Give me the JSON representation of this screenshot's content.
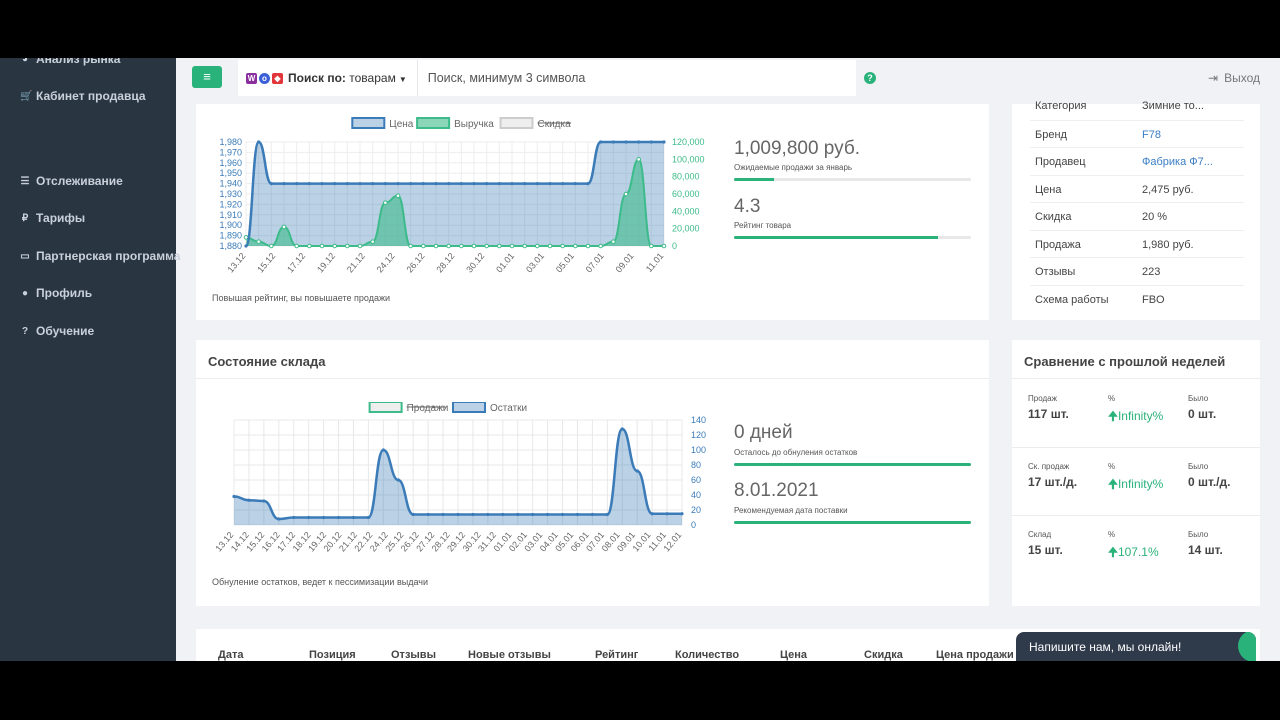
{
  "sidebar": {
    "items": [
      {
        "icon": "pie-chart-icon",
        "label": "Анализ рынка"
      },
      {
        "icon": "cart-icon",
        "label": "Кабинет продавца"
      },
      {
        "icon": "list-icon",
        "label": "Отслеживание"
      },
      {
        "icon": "ruble-icon",
        "label": "Тарифы"
      },
      {
        "icon": "id-card-icon",
        "label": "Партнерская программа"
      },
      {
        "icon": "user-icon",
        "label": "Профиль"
      },
      {
        "icon": "question-icon",
        "label": "Обучение"
      }
    ]
  },
  "topbar": {
    "search_by_label": "Поиск по:",
    "search_by_value": "товарам",
    "search_placeholder": "Поиск, минимум 3 символа",
    "help": "?",
    "logout": "Выход"
  },
  "sales_card": {
    "revenue_value": "1,009,800 руб.",
    "revenue_caption": "Ожидаемые продажи за январь",
    "revenue_progress": 0.17,
    "rating_value": "4.3",
    "rating_caption": "Рейтинг товара",
    "rating_progress": 0.86,
    "note": "Повышая рейтинг, вы повышаете продажи"
  },
  "info": {
    "rows": [
      {
        "k": "Категория",
        "v": "Зимние то..."
      },
      {
        "k": "Бренд",
        "v": "F78",
        "link": true
      },
      {
        "k": "Продавец",
        "v": "Фабрика Ф7...",
        "link": true
      },
      {
        "k": "Цена",
        "v": "2,475 руб."
      },
      {
        "k": "Скидка",
        "v": "20 %"
      },
      {
        "k": "Продажа",
        "v": "1,980 руб."
      },
      {
        "k": "Отзывы",
        "v": "223"
      },
      {
        "k": "Схема работы",
        "v": "FBO"
      }
    ]
  },
  "stock_card": {
    "title": "Состояние склада",
    "days_value": "0 дней",
    "days_caption": "Осталось до обнуления остатков",
    "days_progress": 1.0,
    "date_value": "8.01.2021",
    "date_caption": "Рекомендуемая дата поставки",
    "date_progress": 1.0,
    "note": "Обнуление остатков, ведет к пессимизации выдачи"
  },
  "compare": {
    "title": "Сравнение с прошлой неделей",
    "rows": [
      {
        "l1": "Продаж",
        "v1": "117 шт.",
        "l2": "%",
        "v2": "Infinity%",
        "l3": "Было",
        "v3": "0 шт."
      },
      {
        "l1": "Ск. продаж",
        "v1": "17 шт./д.",
        "l2": "%",
        "v2": "Infinity%",
        "l3": "Было",
        "v3": "0 шт./д."
      },
      {
        "l1": "Склад",
        "v1": "15 шт.",
        "l2": "%",
        "v2": "107.1%",
        "l3": "Было",
        "v3": "14 шт."
      }
    ]
  },
  "table": {
    "headers": [
      "Дата",
      "Позиция",
      "Отзывы",
      "Новые отзывы",
      "Рейтинг",
      "Количество",
      "Цена",
      "Скидка",
      "Цена продажи"
    ]
  },
  "chat": {
    "label": "Напишите нам, мы онлайн!"
  },
  "colors": {
    "green": "#2ab27b",
    "blue": "#3a7bb8",
    "sidebar": "#2a3542"
  },
  "chart_data": [
    {
      "type": "line",
      "legend_position": "top",
      "series": [
        {
          "name": "Цена",
          "axis": "left",
          "color": "#3a7bb8",
          "fill": "rgba(58,123,184,0.35)",
          "values": [
            1880,
            1980,
            1940,
            1940,
            1940,
            1940,
            1940,
            1940,
            1940,
            1940,
            1940,
            1940,
            1940,
            1940,
            1940,
            1940,
            1940,
            1940,
            1940,
            1940,
            1940,
            1940,
            1940,
            1940,
            1940,
            1940,
            1940,
            1940,
            1980,
            1980,
            1980,
            1980,
            1980,
            1980
          ]
        },
        {
          "name": "Выручка",
          "axis": "right",
          "color": "#3dbb8a",
          "fill": "rgba(61,187,138,0.6)",
          "values": [
            10000,
            5000,
            0,
            22000,
            0,
            0,
            0,
            0,
            0,
            0,
            5000,
            50000,
            58000,
            0,
            0,
            0,
            0,
            0,
            0,
            0,
            0,
            0,
            0,
            0,
            0,
            0,
            0,
            0,
            0,
            5000,
            60000,
            100000,
            0,
            0
          ]
        },
        {
          "name": "Скидка",
          "axis": "none",
          "color": "#cccccc",
          "hidden": true,
          "values": []
        }
      ],
      "x_ticks": [
        "13.12",
        "15.12",
        "17.12",
        "19.12",
        "21.12",
        "24.12",
        "26.12",
        "28.12",
        "30.12",
        "01.01",
        "03.01",
        "05.01",
        "07.01",
        "09.01",
        "11.01"
      ],
      "y_left": {
        "min": 1880,
        "max": 1980,
        "ticks": [
          "1,880",
          "1,890",
          "1,900",
          "1,910",
          "1,920",
          "1,930",
          "1,940",
          "1,950",
          "1,960",
          "1,970",
          "1,980"
        ]
      },
      "y_right": {
        "min": 0,
        "max": 120000,
        "ticks": [
          "0",
          "20,000",
          "40,000",
          "60,000",
          "80,000",
          "100,000",
          "120,000"
        ]
      },
      "grid": true
    },
    {
      "type": "line",
      "legend_position": "top",
      "series": [
        {
          "name": "Продажи",
          "color": "#3dbb8a",
          "hidden": true,
          "values": []
        },
        {
          "name": "Остатки",
          "axis": "right",
          "color": "#3a7bb8",
          "fill": "rgba(58,123,184,0.35)",
          "values": [
            38,
            33,
            32,
            8,
            10,
            10,
            10,
            10,
            10,
            10,
            100,
            60,
            14,
            14,
            14,
            14,
            14,
            14,
            14,
            14,
            14,
            14,
            14,
            14,
            14,
            14,
            128,
            72,
            15,
            15,
            15
          ]
        }
      ],
      "x_ticks": [
        "13.12",
        "14.12",
        "15.12",
        "16.12",
        "17.12",
        "18.12",
        "19.12",
        "20.12",
        "21.12",
        "22.12",
        "24.12",
        "25.12",
        "26.12",
        "27.12",
        "28.12",
        "29.12",
        "30.12",
        "31.12",
        "01.01",
        "02.01",
        "03.01",
        "04.01",
        "05.01",
        "06.01",
        "07.01",
        "08.01",
        "09.01",
        "10.01",
        "11.01",
        "12.01"
      ],
      "y_right": {
        "min": 0,
        "max": 140,
        "ticks": [
          "0",
          "20",
          "40",
          "60",
          "80",
          "100",
          "120",
          "140"
        ]
      },
      "grid": true
    }
  ]
}
